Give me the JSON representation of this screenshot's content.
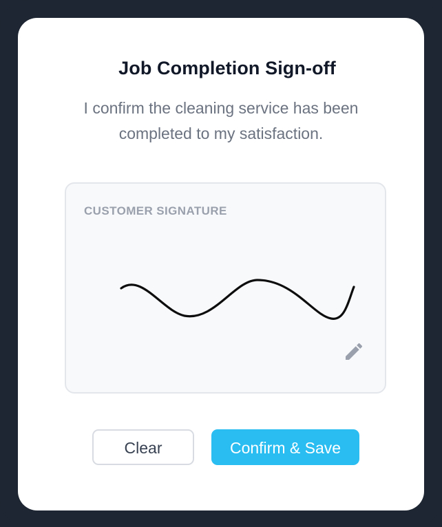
{
  "dialog": {
    "title": "Job Completion Sign-off",
    "description": "I confirm the cleaning service has been completed to my satisfaction."
  },
  "signature_pad": {
    "label": "CUSTOMER SIGNATURE",
    "has_signature": true,
    "edit_icon": "pencil-icon"
  },
  "actions": {
    "clear_label": "Clear",
    "confirm_label": "Confirm & Save",
    "confirm_color": "#29bdf2"
  }
}
